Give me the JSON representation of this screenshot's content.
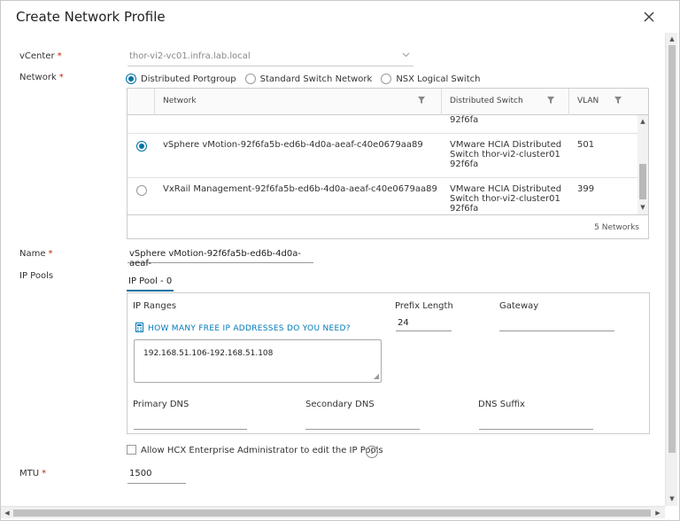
{
  "dialog": {
    "title": "Create Network Profile"
  },
  "form": {
    "vcenter_label": "vCenter",
    "vcenter_value": "thor-vi2-vc01.infra.lab.local",
    "network_label": "Network",
    "network_options": [
      "Distributed Portgroup",
      "Standard Switch Network",
      "NSX Logical Switch"
    ],
    "network_selected_index": 0,
    "name_label": "Name",
    "name_value": "vSphere vMotion-92f6fa5b-ed6b-4d0a-aeaf-",
    "ip_pools_label": "IP Pools",
    "mtu_label": "MTU",
    "mtu_value": "1500",
    "required_mark": "*"
  },
  "network_table": {
    "columns": [
      "Network",
      "Distributed Switch",
      "VLAN"
    ],
    "partial_row_switch": "92f6fa",
    "rows": [
      {
        "selected": true,
        "network": "vSphere vMotion-92f6fa5b-ed6b-4d0a-aeaf-c40e0679aa89",
        "switch_lines": [
          "VMware HCIA Distributed",
          "Switch thor-vi2-cluster01",
          "92f6fa"
        ],
        "vlan": "501"
      },
      {
        "selected": false,
        "network": "VxRail Management-92f6fa5b-ed6b-4d0a-aeaf-c40e0679aa89",
        "switch_lines": [
          "VMware HCIA Distributed",
          "Switch thor-vi2-cluster01",
          "92f6fa"
        ],
        "vlan": "399"
      }
    ],
    "footer": "5 Networks"
  },
  "ip_pool": {
    "tab_label": "IP Pool - 0",
    "ip_ranges_label": "IP Ranges",
    "free_ip_link": "HOW MANY FREE IP ADDRESSES DO YOU NEED?",
    "ip_ranges_value": "192.168.51.106-192.168.51.108",
    "prefix_length_label": "Prefix Length",
    "prefix_length_value": "24",
    "gateway_label": "Gateway",
    "gateway_value": "",
    "primary_dns_label": "Primary DNS",
    "secondary_dns_label": "Secondary DNS",
    "dns_suffix_label": "DNS Suffix"
  },
  "allow_edit": {
    "label": "Allow HCX Enterprise Administrator to edit the IP Pools",
    "checked": false
  },
  "colors": {
    "accent": "#0072a3",
    "link": "#0079b8",
    "required": "#c92100"
  }
}
